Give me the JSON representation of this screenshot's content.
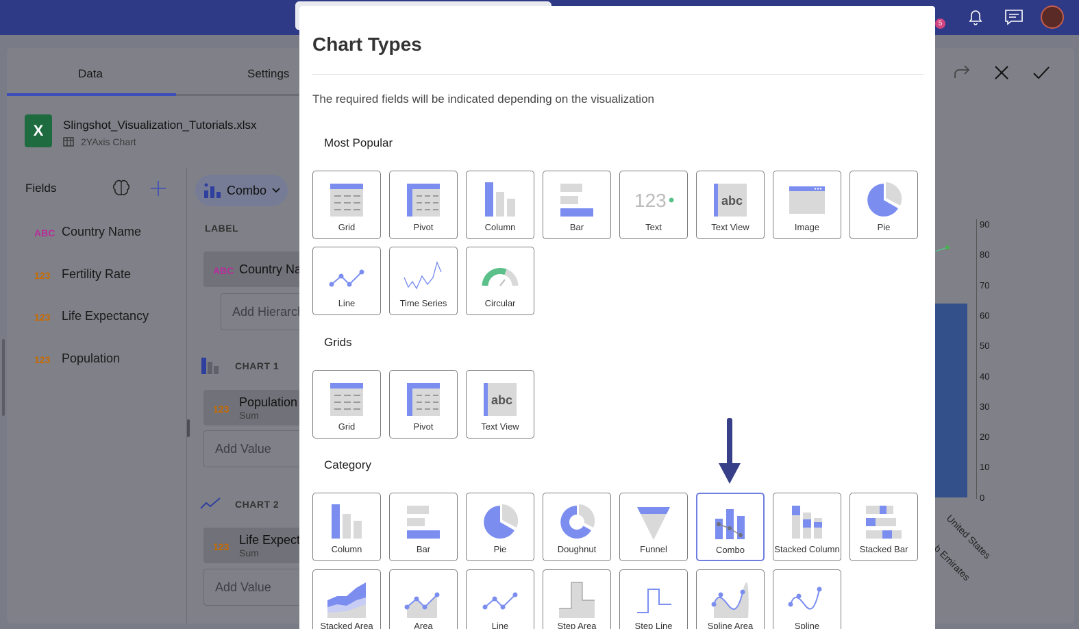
{
  "topbar": {
    "notification_badge": "5",
    "icons": [
      "notification-bell-icon",
      "chat-icon",
      "avatar"
    ]
  },
  "tabs": [
    {
      "label": "Data"
    },
    {
      "label": "Settings"
    }
  ],
  "file": {
    "name": "Slingshot_Visualization_Tutorials.xlsx",
    "sheet": "2YAxis Chart",
    "icon_text": "X"
  },
  "fields": {
    "title": "Fields",
    "items": [
      {
        "type": "ABC",
        "label": "Country Name"
      },
      {
        "type": "123",
        "label": "Fertility Rate"
      },
      {
        "type": "123",
        "label": "Life Expectancy"
      },
      {
        "type": "123",
        "label": "Population"
      }
    ]
  },
  "editor": {
    "chart_type": "Combo",
    "label_section": "LABEL",
    "label_type": "ABC",
    "label_field": "Country Na",
    "add_hierarchy": "Add Hierarch",
    "chart1": {
      "title": "CHART 1",
      "type": "123",
      "field": "Population",
      "agg": "Sum",
      "add": "Add Value"
    },
    "chart2": {
      "title": "CHART 2",
      "type": "123",
      "field": "Life Expect",
      "agg": "Sum",
      "add": "Add Value"
    }
  },
  "preview": {
    "y_ticks": [
      "90",
      "80",
      "70",
      "60",
      "50",
      "40",
      "30",
      "20",
      "10",
      "0"
    ],
    "x_labels": [
      "United States",
      "b Emirates"
    ],
    "bar_color": "#34508a"
  },
  "dialog": {
    "title": "Chart Types",
    "description": "The required fields will be indicated depending on the visualization",
    "sections": {
      "popular": {
        "title": "Most Popular",
        "tiles": [
          "Grid",
          "Pivot",
          "Column",
          "Bar",
          "Text",
          "Text View",
          "Image",
          "Pie",
          "Line",
          "Time Series",
          "Circular"
        ]
      },
      "grids": {
        "title": "Grids",
        "tiles": [
          "Grid",
          "Pivot",
          "Text View"
        ]
      },
      "category": {
        "title": "Category",
        "tiles": [
          "Column",
          "Bar",
          "Pie",
          "Doughnut",
          "Funnel",
          "Combo",
          "Stacked Column",
          "Stacked Bar",
          "Stacked Area",
          "Area",
          "Line",
          "Step Area",
          "Step Line",
          "Spline Area",
          "Spline"
        ]
      }
    },
    "selected": "Combo",
    "icon_text": {
      "text_tile": "123",
      "textview_tile": "abc"
    },
    "colors": {
      "accent": "#7b8ef0",
      "muted": "#d9d9d9",
      "gauge": "#5cc08a"
    }
  }
}
